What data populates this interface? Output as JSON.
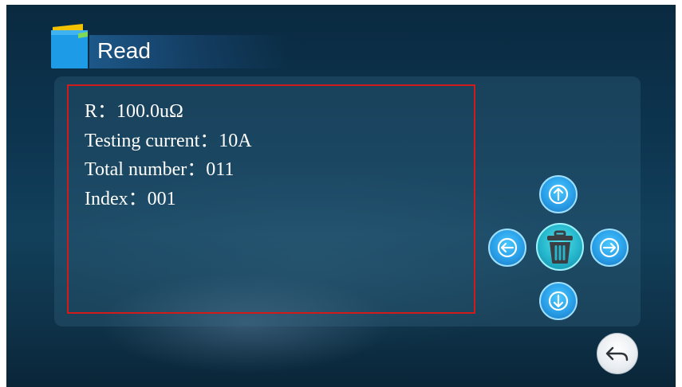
{
  "header": {
    "title": "Read"
  },
  "readout": {
    "lines": [
      "R：100.0uΩ",
      "Testing current：10A",
      "Total number：011",
      "Index：001"
    ]
  },
  "controls": {
    "up": "arrow-up-icon",
    "down": "arrow-down-icon",
    "left": "arrow-left-icon",
    "right": "arrow-right-icon",
    "delete": "trash-icon",
    "back": "return-arrow-icon"
  },
  "colors": {
    "frame_border": "#d11a1a",
    "arrow_button": "#2a9fe8",
    "delete_button": "#25b6cc",
    "back_button": "#e9edf1"
  }
}
